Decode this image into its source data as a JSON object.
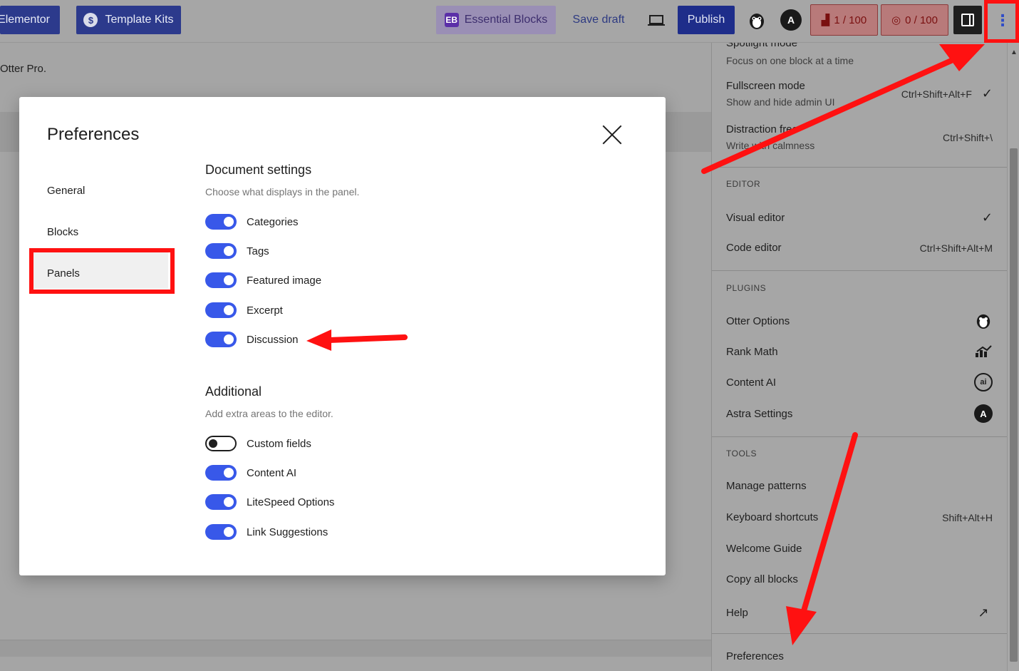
{
  "toolbar": {
    "elementor_label": "Elementor",
    "template_kits_label": "Template Kits",
    "essential_blocks_label": "Essential Blocks",
    "save_draft_label": "Save draft",
    "publish_label": "Publish",
    "astra_letter": "A",
    "rank_math_score": "1 / 100",
    "content_ai_score": "0 / 100",
    "more_icon": "⋮"
  },
  "background": {
    "text": "Otter Pro."
  },
  "menu": {
    "spotlight": {
      "label": "Spotlight mode",
      "sub": "Focus on one block at a time"
    },
    "fullscreen": {
      "label": "Fullscreen mode",
      "sub": "Show and hide admin UI",
      "shortcut": "Ctrl+Shift+Alt+F",
      "check": "✓"
    },
    "distraction": {
      "label": "Distraction free",
      "sub": "Write with calmness",
      "shortcut": "Ctrl+Shift+\\"
    },
    "editor_title": "EDITOR",
    "visual_editor": {
      "label": "Visual editor",
      "check": "✓"
    },
    "code_editor": {
      "label": "Code editor",
      "shortcut": "Ctrl+Shift+Alt+M"
    },
    "plugins_title": "PLUGINS",
    "otter_options": {
      "label": "Otter Options"
    },
    "rank_math": {
      "label": "Rank Math"
    },
    "content_ai": {
      "label": "Content AI",
      "icon_text": "ai"
    },
    "astra_settings": {
      "label": "Astra Settings",
      "icon_text": "A"
    },
    "tools_title": "TOOLS",
    "manage_patterns": {
      "label": "Manage patterns"
    },
    "keyboard_shortcuts": {
      "label": "Keyboard shortcuts",
      "shortcut": "Shift+Alt+H"
    },
    "welcome_guide": {
      "label": "Welcome Guide"
    },
    "copy_all_blocks": {
      "label": "Copy all blocks"
    },
    "help": {
      "label": "Help",
      "icon": "↗"
    },
    "preferences": {
      "label": "Preferences"
    }
  },
  "modal": {
    "title": "Preferences",
    "nav": [
      {
        "label": "General"
      },
      {
        "label": "Blocks"
      },
      {
        "label": "Panels"
      }
    ],
    "document_settings": {
      "title": "Document settings",
      "desc": "Choose what displays in the panel.",
      "options": [
        {
          "label": "Categories",
          "on": true
        },
        {
          "label": "Tags",
          "on": true
        },
        {
          "label": "Featured image",
          "on": true
        },
        {
          "label": "Excerpt",
          "on": true
        },
        {
          "label": "Discussion",
          "on": true
        }
      ]
    },
    "additional": {
      "title": "Additional",
      "desc": "Add extra areas to the editor.",
      "options": [
        {
          "label": "Custom fields",
          "on": false
        },
        {
          "label": "Content AI",
          "on": true
        },
        {
          "label": "LiteSpeed Options",
          "on": true
        },
        {
          "label": "Link Suggestions",
          "on": true
        }
      ]
    }
  },
  "colors": {
    "accent": "#3858e9",
    "annotation_red": "#ff1111",
    "publish": "#1e2d8a"
  }
}
